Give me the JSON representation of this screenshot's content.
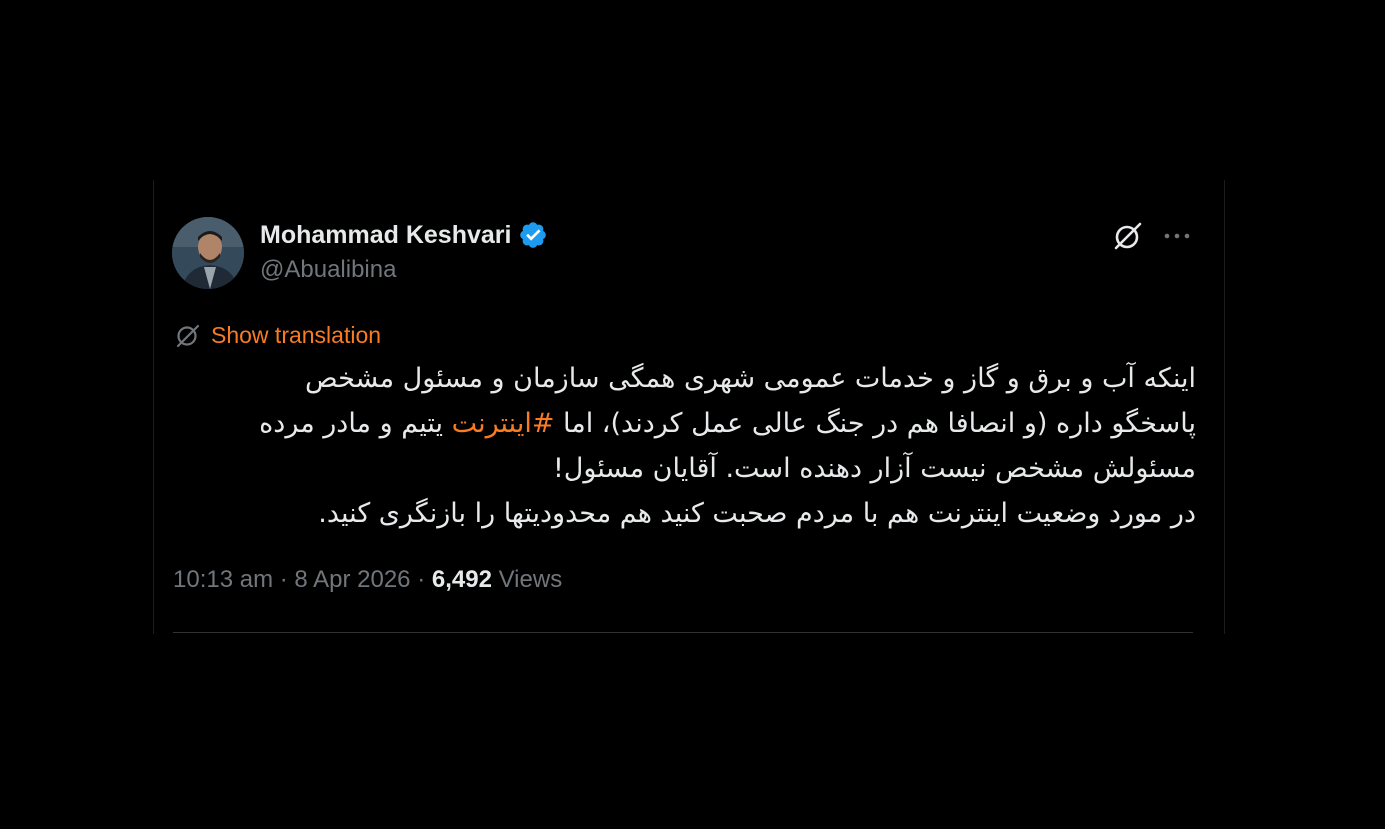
{
  "author": {
    "display_name": "Mohammad Keshvari",
    "handle": "@Abualibina",
    "verified": true,
    "verified_icon": "verified-badge-icon"
  },
  "actions": {
    "grok_icon": "grok-icon",
    "more_icon": "more-dots-icon"
  },
  "translation": {
    "label": "Show translation",
    "icon": "translate-icon"
  },
  "tweet": {
    "line1": "اینکه آب و برق و گاز و خدمات عمومی شهری همگی سازمان و مسئول مشخص",
    "line2_before": "پاسخگو داره (و انصافا هم در جنگ عالی عمل کردند)، اما ",
    "hashtag": "#اینترنت",
    "line2_after": " یتیم و مادر مرده",
    "line3": "مسئولش مشخص نیست آزار دهنده است. آقایان مسئول!",
    "line4": " در مورد وضعیت اینترنت هم با مردم صحبت کنید هم محدودیتها را بازنگری کنید."
  },
  "meta": {
    "time": "10:13 am",
    "separator": "·",
    "date": "8 Apr 2026",
    "views_count": "6,492",
    "views_label": "Views"
  },
  "colors": {
    "background": "#000000",
    "text": "#e7e9ea",
    "muted": "#71767b",
    "accent": "#f97b22",
    "verified": "#1d9bf0",
    "divider": "#2f3336"
  }
}
